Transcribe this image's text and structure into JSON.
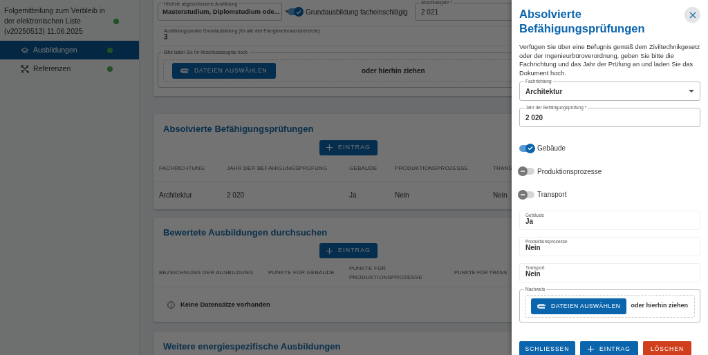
{
  "sidebar": {
    "header": {
      "text": "Folgemitteilung zum Verbleib in der elektronischen Liste (v20250513) 11.06.2025",
      "complete": true
    },
    "items": [
      {
        "label": "Ausbildungen",
        "selected": true,
        "complete": true
      },
      {
        "label": "Referenzen",
        "selected": false,
        "complete": true
      }
    ]
  },
  "education_card": {
    "degree_select": {
      "label": "Höchste abgeschlossene Ausbildung",
      "value": "Masterstudium, Diplomstudium ode..."
    },
    "relevant_switch": {
      "label": "Grundausbildung facheinschlägig",
      "on": true
    },
    "year_field": {
      "label": "Abschlussjahr *",
      "value": "2 021"
    },
    "points_field": {
      "label": "Ausbildungspunkte Grundausbildung (für alle drei Energieverbrauchsbereiche)",
      "value": "3"
    },
    "upload": {
      "legend": "Bitte laden Sie Ihr Abschlusszeugnis hoch.",
      "button": "DATEIEN AUSWÄHLEN",
      "drop_text": "oder hierhin ziehen"
    }
  },
  "exams_card": {
    "title": "Absolvierte Befähigungsprüfungen",
    "add_button": "EINTRAG",
    "columns": [
      "FACHRICHTUNG",
      "JAHR DER BEFÄHIGUNGSPRÜFUNG",
      "GEBÄUDE",
      "PRODUKTIONSPROZESSE",
      "TRANS"
    ],
    "rows": [
      [
        "Architektur",
        "2 020",
        "Ja",
        "Nein",
        "Nein"
      ]
    ]
  },
  "search_card": {
    "title": "Bewertete Ausbildungen durchsuchen",
    "add_button": "EINTRAG",
    "columns": [
      "BEZEICHNUNG DER AUSBILDUNG",
      "PUNKTE FÜR GEBÄUDE",
      "PUNKTE FÜR PRODUKTIONSPROZESSE",
      "PUNKTE FÜR TRANS"
    ],
    "empty_text": "Keine Datensätze vorhanden"
  },
  "further_card": {
    "title": "Weitere energiespezifische Ausbildungen"
  },
  "drawer": {
    "title": "Absolvierte Befähigungsprüfungen",
    "description": "Verfügen Sie über eine Befugnis gemäß dem Ziviltechnikgesetz oder der Ingenieurbüroverordnung, geben Sie bitte die Fachrichtung und das Jahr der Prüfung an und laden Sie das Dokument hoch.",
    "fields": [
      {
        "kind": "select",
        "label": "Fachrichtung",
        "value": "Architektur"
      },
      {
        "kind": "input",
        "label": "Jahr der Befähigungsprüfung *",
        "value": "2 020"
      }
    ],
    "toggles": [
      {
        "label": "Gebäude",
        "on": true
      },
      {
        "label": "Produktionsprozesse",
        "on": false
      },
      {
        "label": "Transport",
        "on": false
      }
    ],
    "readonly_fields": [
      {
        "label": "Gebäude",
        "value": "Ja"
      },
      {
        "label": "Produktionsprozesse",
        "value": "Nein"
      },
      {
        "label": "Transport",
        "value": "Nein"
      }
    ],
    "upload": {
      "legend": "Nachweis",
      "button": "DATEIEN AUSWÄHLEN",
      "drop_text": "oder hierhin ziehen"
    },
    "buttons": [
      {
        "label": "SCHLIESSEN",
        "kind": "primary"
      },
      {
        "label": "EINTRAG",
        "kind": "add"
      },
      {
        "label": "LÖSCHEN",
        "kind": "danger"
      }
    ]
  }
}
